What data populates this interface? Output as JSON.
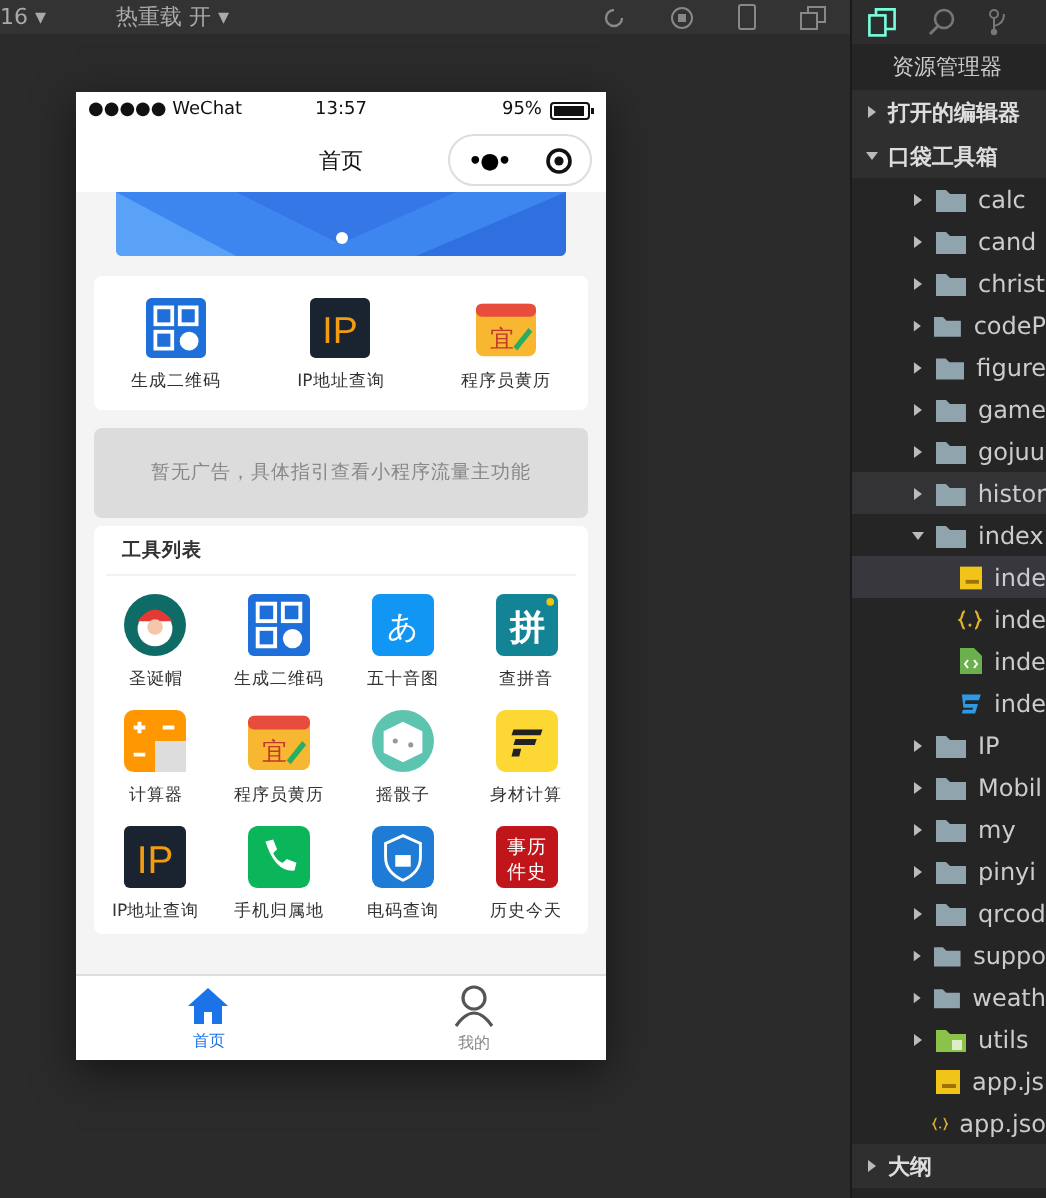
{
  "toolbar": {
    "items": [
      {
        "label": "16 ▾"
      },
      {
        "label": "热重载 开 ▾"
      }
    ]
  },
  "phone": {
    "status_bar": {
      "carrier": "●●●●● WeChat",
      "time": "13:57",
      "battery": "95%"
    },
    "nav": {
      "title": "首页",
      "capsule_more": "•●•"
    },
    "banner": {
      "kind": "picture",
      "dots": [
        {
          "selected": true
        }
      ]
    },
    "quick": [
      {
        "label": "生成二维码",
        "kind": "qrcode"
      },
      {
        "label": "IP地址查询",
        "kind": "ip",
        "icon_text": "IP"
      },
      {
        "label": "程序员黄历",
        "kind": "calendar",
        "icon_text": "宜"
      }
    ],
    "ad": "暂无广告，具体指引查看小程序流量主功能",
    "tools": {
      "title": "工具列表",
      "items": [
        {
          "label": "圣诞帽",
          "kind": "santa"
        },
        {
          "label": "生成二维码",
          "kind": "qrcode"
        },
        {
          "label": "五十音图",
          "kind": "kana",
          "icon_text": "あ"
        },
        {
          "label": "查拼音",
          "kind": "pinyin",
          "icon_text": "拼"
        },
        {
          "label": "计算器",
          "kind": "calculator"
        },
        {
          "label": "程序员黄历",
          "kind": "calendar",
          "icon_text": "宜"
        },
        {
          "label": "摇骰子",
          "kind": "dice"
        },
        {
          "label": "身材计算",
          "kind": "figure"
        },
        {
          "label": "IP地址查询",
          "kind": "ip",
          "icon_text": "IP"
        },
        {
          "label": "手机归属地",
          "kind": "phone"
        },
        {
          "label": "电码查询",
          "kind": "shield"
        },
        {
          "label": "历史今天",
          "kind": "history",
          "icon_text": "事历件史"
        }
      ]
    },
    "tabbar": [
      {
        "label": "首页",
        "kind": "home",
        "selected": true
      },
      {
        "label": "我的",
        "kind": "user",
        "selected": false
      }
    ]
  },
  "explorer": {
    "title": "资源管理器",
    "sections": [
      {
        "label": "打开的编辑器",
        "expanded": false
      },
      {
        "label": "口袋工具箱",
        "expanded": true,
        "children": [
          {
            "name": "calc",
            "kind": "folder",
            "expanded": false
          },
          {
            "name": "cand",
            "kind": "folder",
            "expanded": false
          },
          {
            "name": "christ",
            "kind": "folder",
            "expanded": false
          },
          {
            "name": "codeP",
            "kind": "folder",
            "expanded": false
          },
          {
            "name": "figure",
            "kind": "folder",
            "expanded": false
          },
          {
            "name": "game",
            "kind": "folder",
            "expanded": false
          },
          {
            "name": "gojuu",
            "kind": "folder",
            "expanded": false
          },
          {
            "name": "histor",
            "kind": "folder",
            "expanded": false,
            "hovered": true
          },
          {
            "name": "index",
            "kind": "folder",
            "expanded": true,
            "children": [
              {
                "name": "inde",
                "kind": "js",
                "selected": true
              },
              {
                "name": "inde",
                "kind": "json",
                "selected": false
              },
              {
                "name": "inde",
                "kind": "wxml",
                "selected": false
              },
              {
                "name": "inde",
                "kind": "wxss",
                "selected": false
              }
            ]
          },
          {
            "name": "IP",
            "kind": "folder",
            "expanded": false
          },
          {
            "name": "Mobil",
            "kind": "folder",
            "expanded": false
          },
          {
            "name": "my",
            "kind": "folder",
            "expanded": false
          },
          {
            "name": "pinyi",
            "kind": "folder",
            "expanded": false
          },
          {
            "name": "qrcod",
            "kind": "folder",
            "expanded": false
          },
          {
            "name": "suppo",
            "kind": "folder",
            "expanded": false
          },
          {
            "name": "weath",
            "kind": "folder",
            "expanded": false
          },
          {
            "name": "utils",
            "kind": "libfolder",
            "expanded": false
          },
          {
            "name": "app.js",
            "kind": "js"
          },
          {
            "name": "app.jso",
            "kind": "json"
          }
        ]
      },
      {
        "label": "大纲",
        "expanded": false
      }
    ]
  }
}
